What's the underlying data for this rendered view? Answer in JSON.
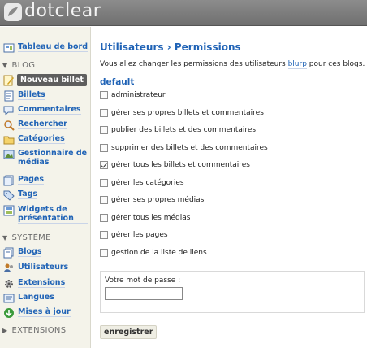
{
  "app": {
    "logo_text": "dotclear"
  },
  "sidebar": {
    "dashboard": "Tableau de bord",
    "blog_section": "BLOG",
    "new_post": "Nouveau billet",
    "blog_items": [
      {
        "label": "Billets",
        "icon": "posts-icon"
      },
      {
        "label": "Commentaires",
        "icon": "comments-icon"
      },
      {
        "label": "Rechercher",
        "icon": "search-icon"
      },
      {
        "label": "Catégories",
        "icon": "categories-icon"
      },
      {
        "label": "Gestionnaire de médias",
        "icon": "media-icon"
      },
      {
        "label": "Pages",
        "icon": "pages-icon"
      },
      {
        "label": "Tags",
        "icon": "tags-icon"
      },
      {
        "label": "Widgets de présentation",
        "icon": "widgets-icon"
      }
    ],
    "system_section": "SYSTÈME",
    "system_items": [
      {
        "label": "Blogs",
        "icon": "blogs-icon"
      },
      {
        "label": "Utilisateurs",
        "icon": "users-icon"
      },
      {
        "label": "Extensions",
        "icon": "plugins-icon"
      },
      {
        "label": "Langues",
        "icon": "languages-icon"
      },
      {
        "label": "Mises à jour",
        "icon": "update-icon"
      }
    ],
    "extensions_section": "EXTENSIONS"
  },
  "main": {
    "title": "Utilisateurs › Permissions",
    "intro_before": "Vous allez changer les permissions des utilisateurs ",
    "intro_user": "blurp",
    "intro_after": " pour ces blogs.",
    "blog_name": "default",
    "permissions": [
      {
        "label": "administrateur",
        "checked": false
      },
      {
        "label": "gérer ses propres billets et commentaires",
        "checked": false
      },
      {
        "label": "publier des billets et des commentaires",
        "checked": false
      },
      {
        "label": "supprimer des billets et des commentaires",
        "checked": false
      },
      {
        "label": "gérer tous les billets et commentaires",
        "checked": true
      },
      {
        "label": "gérer les catégories",
        "checked": false
      },
      {
        "label": "gérer ses propres médias",
        "checked": false
      },
      {
        "label": "gérer tous les médias",
        "checked": false
      },
      {
        "label": "gérer les pages",
        "checked": false
      },
      {
        "label": "gestion de la liste de liens",
        "checked": false
      }
    ],
    "password_label": "Votre mot de passe :",
    "password_value": "",
    "save_label": "enregistrer"
  }
}
